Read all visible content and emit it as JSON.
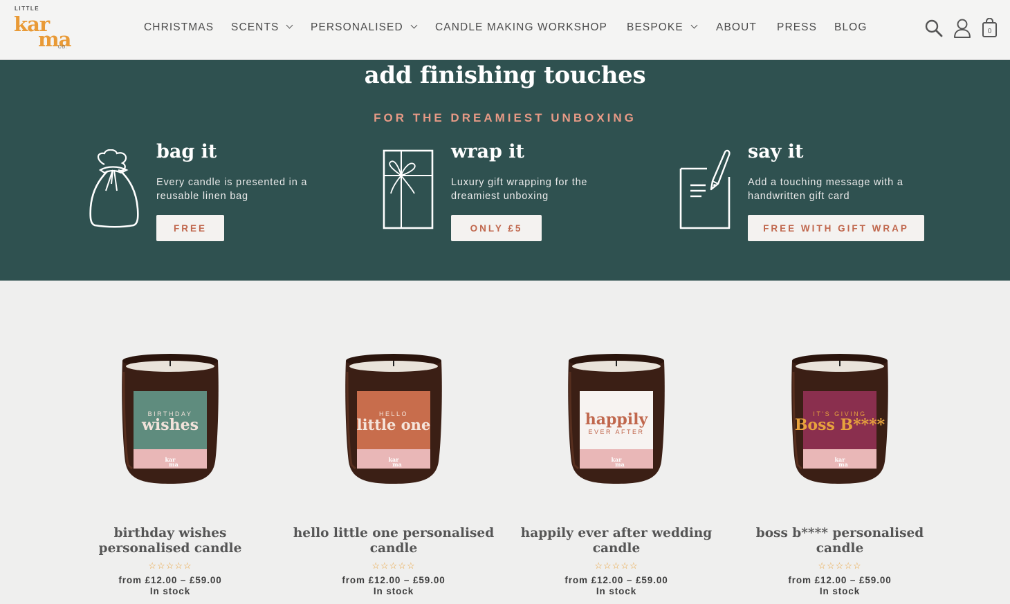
{
  "header": {
    "logo": {
      "little": "LITTLE",
      "kar": "kar",
      "ma": "ma",
      "co": "CO."
    },
    "nav": [
      {
        "label": "CHRISTMAS",
        "dropdown": false
      },
      {
        "label": "SCENTS",
        "dropdown": true
      },
      {
        "label": "PERSONALISED",
        "dropdown": true
      },
      {
        "label": "CANDLE MAKING WORKSHOP",
        "dropdown": false
      },
      {
        "label": "BESPOKE",
        "dropdown": true
      },
      {
        "label": "ABOUT",
        "dropdown": false
      },
      {
        "label": "PRESS",
        "dropdown": false
      },
      {
        "label": "BLOG",
        "dropdown": false
      }
    ],
    "icons": {
      "search": "search-icon",
      "account": "user-icon",
      "cart": "shopping-bag-icon"
    },
    "cart_count": "0"
  },
  "banner": {
    "title": "add finishing touches",
    "subtitle": "FOR THE DREAMIEST UNBOXING",
    "features": [
      {
        "title": "bag it",
        "desc": "Every candle is presented in a reusable linen bag",
        "button": "FREE",
        "icon": "linen-bag-icon"
      },
      {
        "title": "wrap it",
        "desc": "Luxury gift wrapping for the dreamiest unboxing",
        "button": "ONLY £5",
        "icon": "gift-box-icon"
      },
      {
        "title": "say it",
        "desc": "Add a touching message with a handwritten gift card",
        "button": "FREE WITH GIFT WRAP",
        "icon": "gift-card-pen-icon"
      }
    ]
  },
  "products": [
    {
      "name": "birthday wishes personalised candle",
      "price": "from £12.00 – £59.00",
      "stock": "In stock",
      "stars": "☆☆☆☆☆",
      "label_small": "BIRTHDAY",
      "label_big": "wishes",
      "label_color": "#5f8c7e",
      "big_color": "#f1e2da",
      "small_color": "#f1e2da"
    },
    {
      "name": "hello little one personalised candle",
      "price": "from £12.00 – £59.00",
      "stock": "In stock",
      "stars": "☆☆☆☆☆",
      "label_small": "HELLO",
      "label_big": "little one",
      "label_color": "#c86d4c",
      "big_color": "#f5e4da",
      "small_color": "#f5e4da"
    },
    {
      "name": "happily ever after wedding candle",
      "price": "from £12.00 – £59.00",
      "stock": "In stock",
      "stars": "☆☆☆☆☆",
      "label_small": "EVER AFTER",
      "label_big": "happily",
      "label_color": "#f7f3f1",
      "big_color": "#c0674d",
      "small_color": "#c0674d"
    },
    {
      "name": "boss b**** personalised candle",
      "price": "from £12.00 – £59.00",
      "stock": "In stock",
      "stars": "☆☆☆☆☆",
      "label_small": "IT'S GIVING",
      "label_big": "Boss B****",
      "label_color": "#8a2f4e",
      "big_color": "#e7a23d",
      "small_color": "#e7a23d"
    }
  ]
}
